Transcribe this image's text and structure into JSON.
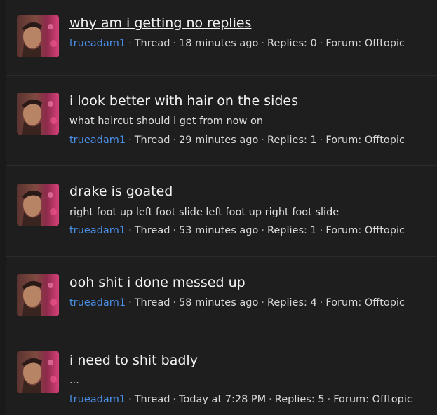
{
  "threads": [
    {
      "title": "why am i getting no replies",
      "snippet": "",
      "user": "trueadam1",
      "type": "Thread",
      "time": "18 minutes ago",
      "replies": "Replies: 0",
      "forum": "Forum: Offtopic"
    },
    {
      "title": "i look better with hair on the sides",
      "snippet": "what haircut should i get from now on",
      "user": "trueadam1",
      "type": "Thread",
      "time": "29 minutes ago",
      "replies": "Replies: 1",
      "forum": "Forum: Offtopic"
    },
    {
      "title": "drake is goated",
      "snippet": "right foot up left foot slide left foot up right foot slide",
      "user": "trueadam1",
      "type": "Thread",
      "time": "53 minutes ago",
      "replies": "Replies: 1",
      "forum": "Forum: Offtopic"
    },
    {
      "title": "ooh shit i done messed up",
      "snippet": "",
      "user": "trueadam1",
      "type": "Thread",
      "time": "58 minutes ago",
      "replies": "Replies: 4",
      "forum": "Forum: Offtopic"
    },
    {
      "title": "i need to shit badly",
      "snippet": "...",
      "user": "trueadam1",
      "type": "Thread",
      "time": "Today at 7:28 PM",
      "replies": "Replies: 5",
      "forum": "Forum: Offtopic"
    }
  ],
  "separator": "·",
  "avatar_icon": "user-avatar-photo"
}
